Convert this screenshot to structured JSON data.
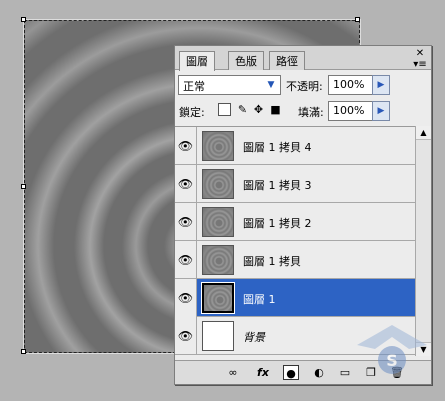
{
  "panel": {
    "tabs": [
      {
        "label": "圖層",
        "active": true
      },
      {
        "label": "色版",
        "active": false
      },
      {
        "label": "路徑",
        "active": false
      }
    ],
    "menu_icon": "panel-menu-icon",
    "blend_mode": "正常",
    "opacity_label": "不透明:",
    "opacity_value": "100%",
    "lock_label": "鎖定:",
    "fill_label": "填滿:",
    "fill_value": "100%",
    "layers": [
      {
        "name": "圖層 1 拷貝 4",
        "visible": true,
        "selected": false
      },
      {
        "name": "圖層 1 拷貝 3",
        "visible": true,
        "selected": false
      },
      {
        "name": "圖層 1 拷貝 2",
        "visible": true,
        "selected": false
      },
      {
        "name": "圖層 1 拷貝",
        "visible": true,
        "selected": false
      },
      {
        "name": "圖層 1",
        "visible": true,
        "selected": true
      },
      {
        "name": "背景",
        "visible": true,
        "selected": false
      }
    ],
    "bottom_icons": [
      "link-icon",
      "fx-icon",
      "mask-icon",
      "adjustment-icon",
      "folder-icon",
      "new-layer-icon",
      "trash-icon"
    ]
  },
  "colors": {
    "selection": "#2d63c4",
    "canvas_gray": "#6e6e6e"
  }
}
